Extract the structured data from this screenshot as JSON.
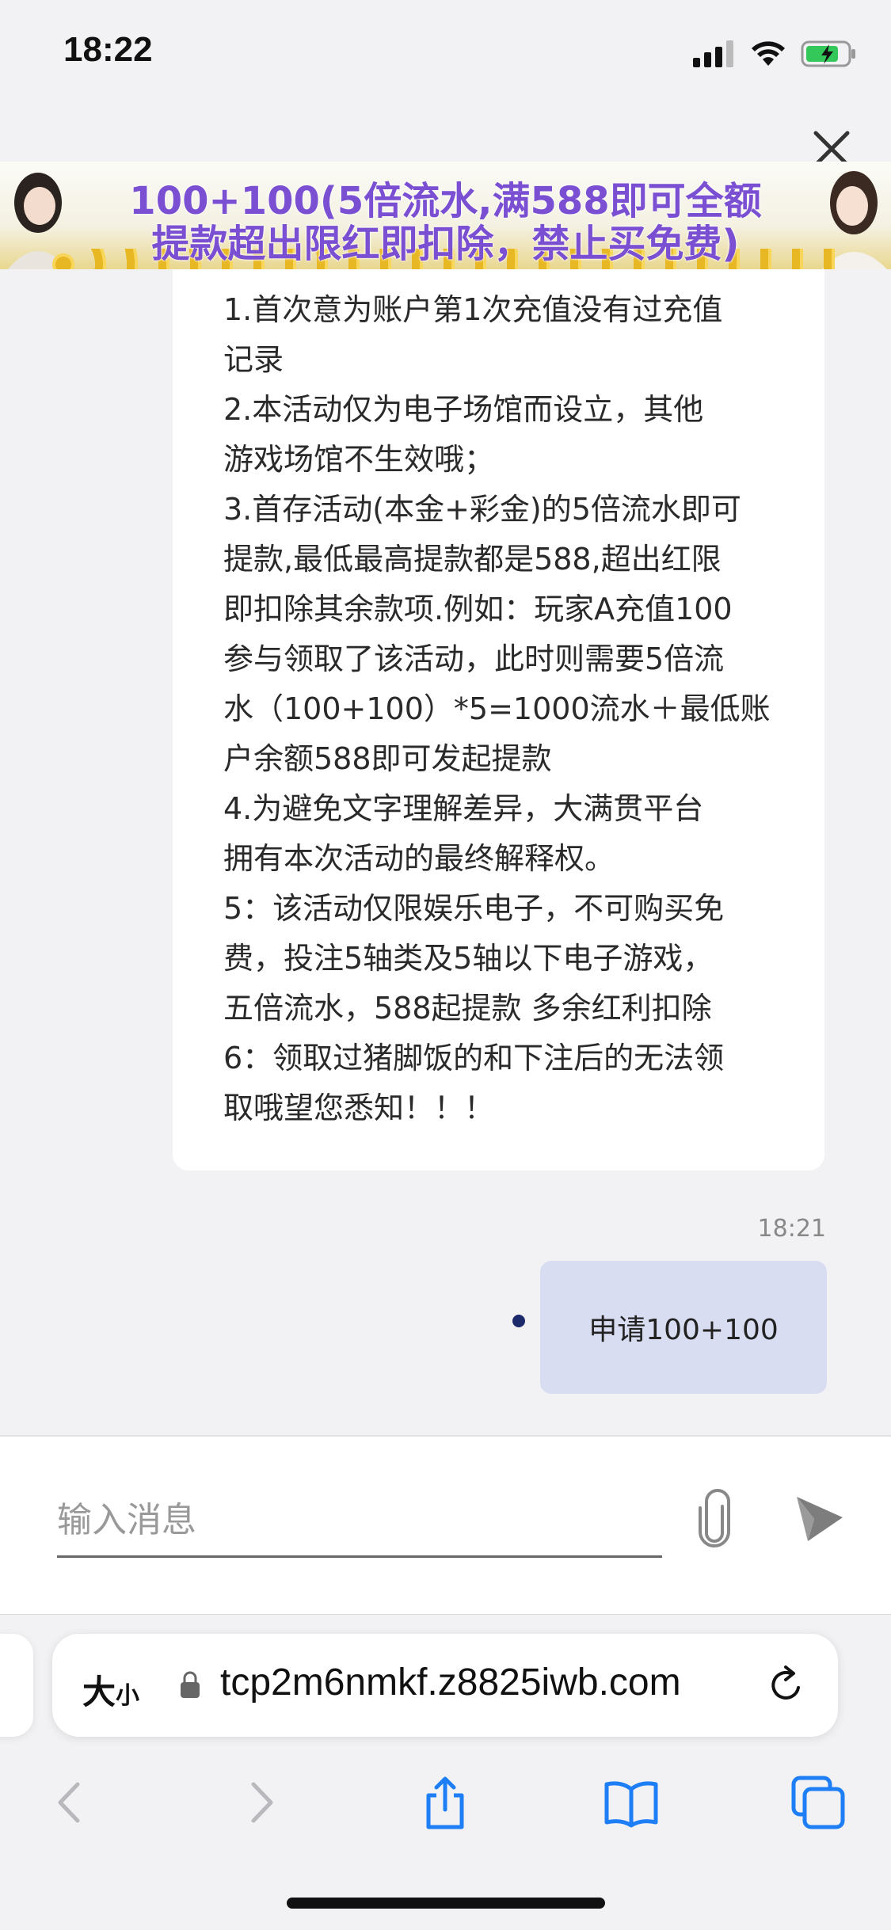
{
  "status_bar": {
    "time": "18:22",
    "icons": [
      "signal-icon",
      "wifi-icon",
      "battery-charging-icon"
    ]
  },
  "banner": {
    "line1": "100+100(5倍流水,满588即可全额",
    "line2": "提款超出限红即扣除，禁止买免费)"
  },
  "messages": {
    "received_text": "1.首次意为账户第1次充值没有过充值\n记录\n2.本活动仅为电子场馆而设立，其他\n游戏场馆不生效哦；\n3.首存活动(本金+彩金)的5倍流水即可\n提款,最低最高提款都是588,超出红限\n即扣除其余款项.例如：玩家A充值100\n参与领取了该活动，此时则需要5倍流\n水（100+100）*5=1000流水＋最低账\n户余额588即可发起提款\n4.为避免文字理解差异，大满贯平台\n拥有本次活动的最终解释权。\n5：该活动仅限娱乐电子，不可购买免\n费，投注5轴类及5轴以下电子游戏，\n五倍流水，588起提款 多余红利扣除\n6：领取过猪脚饭的和下注后的无法领\n取哦望您悉知！！！",
    "sent_time": "18:21",
    "sent_text": "申请100+100"
  },
  "composer": {
    "placeholder": "输入消息"
  },
  "browser": {
    "aa_big": "大",
    "aa_small": "小",
    "url": "tcp2m6nmkf.z8825iwb.com"
  },
  "colors": {
    "accent": "#1e7ef5",
    "sent_bubble": "#d8ddf1",
    "banner_text": "#7a4fd2"
  }
}
